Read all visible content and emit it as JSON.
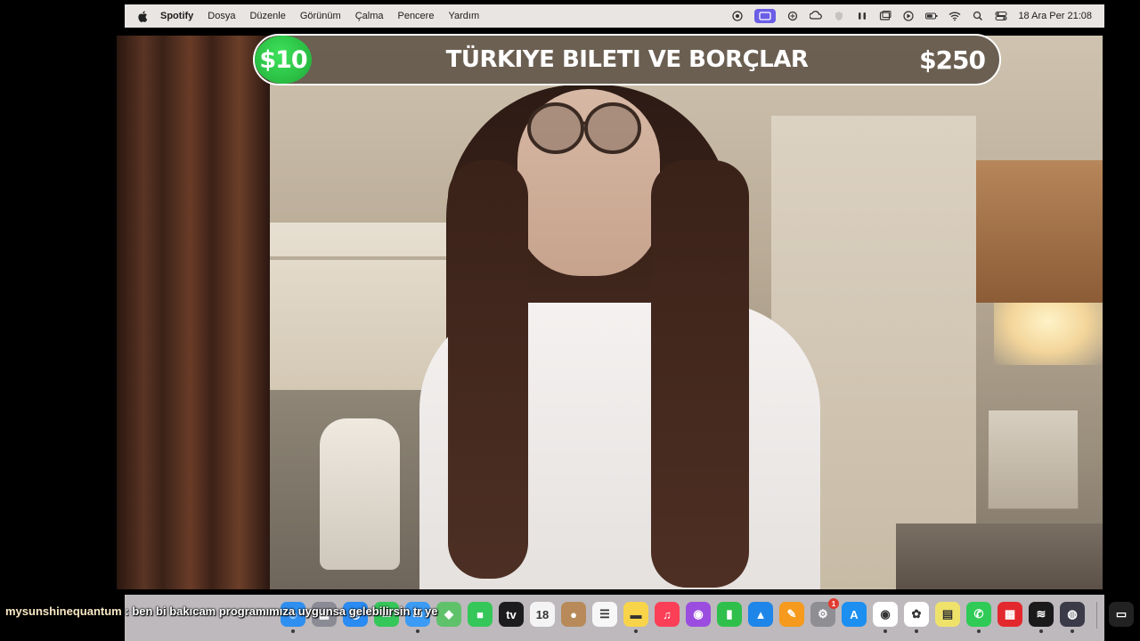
{
  "menubar": {
    "app_name": "Spotify",
    "menus": [
      "Dosya",
      "Düzenle",
      "Görünüm",
      "Çalma",
      "Pencere",
      "Yardım"
    ],
    "clock": "18 Ara Per  21:08",
    "status_icons": [
      "screen-record-icon",
      "menu-extra-active-icon",
      "chatgpt-icon",
      "creative-cloud-icon",
      "shield-icon",
      "airpods-icon",
      "window-icon",
      "play-icon",
      "battery-icon",
      "wifi-icon",
      "spotlight-search-icon",
      "control-center-icon"
    ]
  },
  "banner": {
    "left_value": "$10",
    "title": "TÜRKIYE BILETI VE BORÇLAR",
    "right_value": "$250",
    "accent_color": "#2bc545"
  },
  "chat": {
    "username": "mysunshinequantum",
    "separator": " : ",
    "message": "ben bi bakıcam programımıza uygunsa gelebilirsin tr ye"
  },
  "dock": {
    "apps": [
      {
        "name": "finder-icon",
        "color": "#2e8ff0",
        "glyph": "☺",
        "running": true
      },
      {
        "name": "launchpad-icon",
        "color": "#8b8b95",
        "glyph": "▦",
        "running": false
      },
      {
        "name": "safari-icon",
        "color": "#2a8bf2",
        "glyph": "◎",
        "running": false
      },
      {
        "name": "messages-icon",
        "color": "#35c759",
        "glyph": "✉",
        "running": false
      },
      {
        "name": "mail-icon",
        "color": "#3b9bf5",
        "glyph": "✉",
        "running": true
      },
      {
        "name": "maps-icon",
        "color": "#5fc26b",
        "glyph": "◆",
        "running": false
      },
      {
        "name": "facetime-icon",
        "color": "#35c759",
        "glyph": "■",
        "running": false
      },
      {
        "name": "appletv-icon",
        "color": "#1c1c1e",
        "glyph": "tv",
        "running": false
      },
      {
        "name": "calendar-icon",
        "color": "#f4f4f4",
        "glyph": "18",
        "running": false
      },
      {
        "name": "contacts-icon",
        "color": "#b88a5a",
        "glyph": "●",
        "running": false
      },
      {
        "name": "reminders-icon",
        "color": "#f7f7f7",
        "glyph": "☰",
        "running": false
      },
      {
        "name": "notes-icon",
        "color": "#f8d44a",
        "glyph": "▬",
        "running": true
      },
      {
        "name": "music-icon",
        "color": "#fa3f57",
        "glyph": "♫",
        "running": false
      },
      {
        "name": "podcasts-icon",
        "color": "#9b4de0",
        "glyph": "◉",
        "running": false
      },
      {
        "name": "numbers-icon",
        "color": "#2fc04b",
        "glyph": "▮",
        "running": false
      },
      {
        "name": "keynote-icon",
        "color": "#1e86e8",
        "glyph": "▲",
        "running": false
      },
      {
        "name": "pages-icon",
        "color": "#f59a1c",
        "glyph": "✎",
        "running": false
      },
      {
        "name": "system-settings-icon",
        "color": "#8e8e93",
        "glyph": "⚙",
        "running": false,
        "badge": "1"
      },
      {
        "name": "app-store-icon",
        "color": "#1c8ff0",
        "glyph": "A",
        "running": false
      },
      {
        "name": "chrome-icon",
        "color": "#ffffff",
        "glyph": "◉",
        "running": true
      },
      {
        "name": "chatgpt-app-icon",
        "color": "#ffffff",
        "glyph": "✿",
        "running": true
      },
      {
        "name": "stickies-icon",
        "color": "#efe26b",
        "glyph": "▤",
        "running": false
      },
      {
        "name": "whatsapp-icon",
        "color": "#2fcb56",
        "glyph": "✆",
        "running": true
      },
      {
        "name": "unknown-red-app-icon",
        "color": "#e3282d",
        "glyph": "▩",
        "running": false
      },
      {
        "name": "spotify-icon",
        "color": "#1a1a1a",
        "glyph": "≋",
        "running": true
      },
      {
        "name": "obs-icon",
        "color": "#3a3a48",
        "glyph": "◍",
        "running": true
      },
      {
        "name": "recent-window-1-icon",
        "color": "#222222",
        "glyph": "▭",
        "running": false
      },
      {
        "name": "recent-window-2-icon",
        "color": "#2a2a2a",
        "glyph": "▭",
        "running": false
      },
      {
        "name": "trash-icon",
        "color": "#c9c9cc",
        "glyph": "🗑",
        "running": false
      }
    ]
  }
}
